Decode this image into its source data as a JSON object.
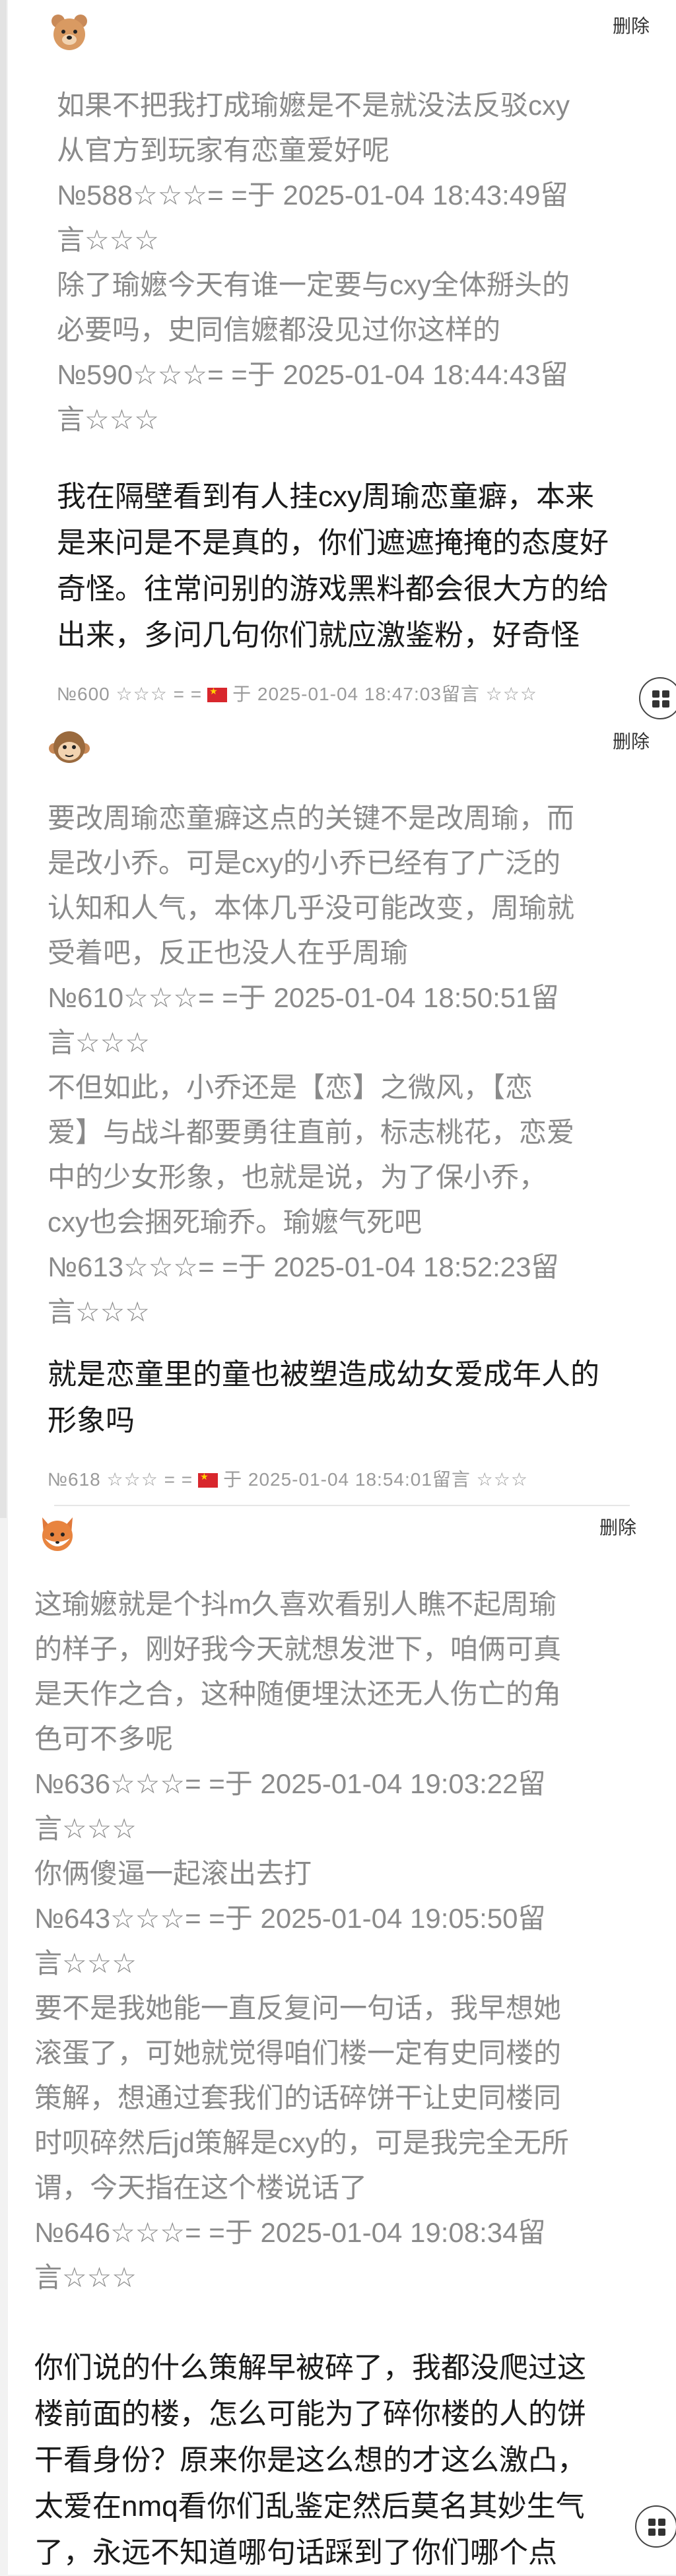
{
  "delete_label": "删除",
  "posts": [
    {
      "avatar": "bear-avatar",
      "quote": "如果不把我打成瑜嬷是不是就没法反驳cxy\n从官方到玩家有恋童爱好呢\n№588☆☆☆= =于 2025-01-04 18:43:49留\n言☆☆☆\n除了瑜嬷今天有谁一定要与cxy全体掰头的\n必要吗，史同信嬷都没见过你这样的\n№590☆☆☆= =于 2025-01-04 18:44:43留\n言☆☆☆",
      "body": "我在隔壁看到有人挂cxy周瑜恋童癖，本来\n是来问是不是真的，你们遮遮掩掩的态度好\n奇怪。往常问别的游戏黑料都会很大方的给\n出来，多问几句你们就应激鉴粉，好奇怪",
      "meta_pre": "№600 ☆☆☆ = =",
      "meta_post": "于 2025-01-04 18:47:03留言 ☆☆☆"
    },
    {
      "avatar": "monkey-avatar",
      "quote": "要改周瑜恋童癖这点的关键不是改周瑜，而\n是改小乔。可是cxy的小乔已经有了广泛的\n认知和人气，本体几乎没可能改变，周瑜就\n受着吧，反正也没人在乎周瑜\n№610☆☆☆= =于 2025-01-04 18:50:51留\n言☆☆☆\n不但如此，小乔还是【恋】之微风，【恋\n爱】与战斗都要勇往直前，标志桃花，恋爱\n中的少女形象，也就是说，为了保小乔，\ncxy也会捆死瑜乔。瑜嬷气死吧\n№613☆☆☆= =于 2025-01-04 18:52:23留\n言☆☆☆",
      "body": "就是恋童里的童也被塑造成幼女爱成年人的\n形象吗",
      "meta_pre": "№618 ☆☆☆ = =",
      "meta_post": "于 2025-01-04 18:54:01留言 ☆☆☆"
    },
    {
      "avatar": "fox-avatar",
      "quote": "这瑜嬷就是个抖m久喜欢看别人瞧不起周瑜\n的样子，刚好我今天就想发泄下，咱俩可真\n是天作之合，这种随便埋汰还无人伤亡的角\n色可不多呢\n№636☆☆☆= =于 2025-01-04 19:03:22留\n言☆☆☆\n你俩傻逼一起滚出去打\n№643☆☆☆= =于 2025-01-04 19:05:50留\n言☆☆☆\n要不是我她能一直反复问一句话，我早想她\n滚蛋了，可她就觉得咱们楼一定有史同楼的\n策解，想通过套我们的话碎饼干让史同楼同\n时呗碎然后jd策解是cxy的，可是我完全无所\n谓，今天指在这个楼说话了\n№646☆☆☆= =于 2025-01-04 19:08:34留\n言☆☆☆",
      "body": "你们说的什么策解早被碎了，我都没爬过这\n楼前面的楼，怎么可能为了碎你楼的人的饼\n干看身份？原来你是这么想的才这么激凸，\n太爱在nmq看你们乱鉴定然后莫名其妙生气\n了，永远不知道哪句话踩到了你们哪个点"
    }
  ],
  "menu_icon": "grid-menu-icon"
}
